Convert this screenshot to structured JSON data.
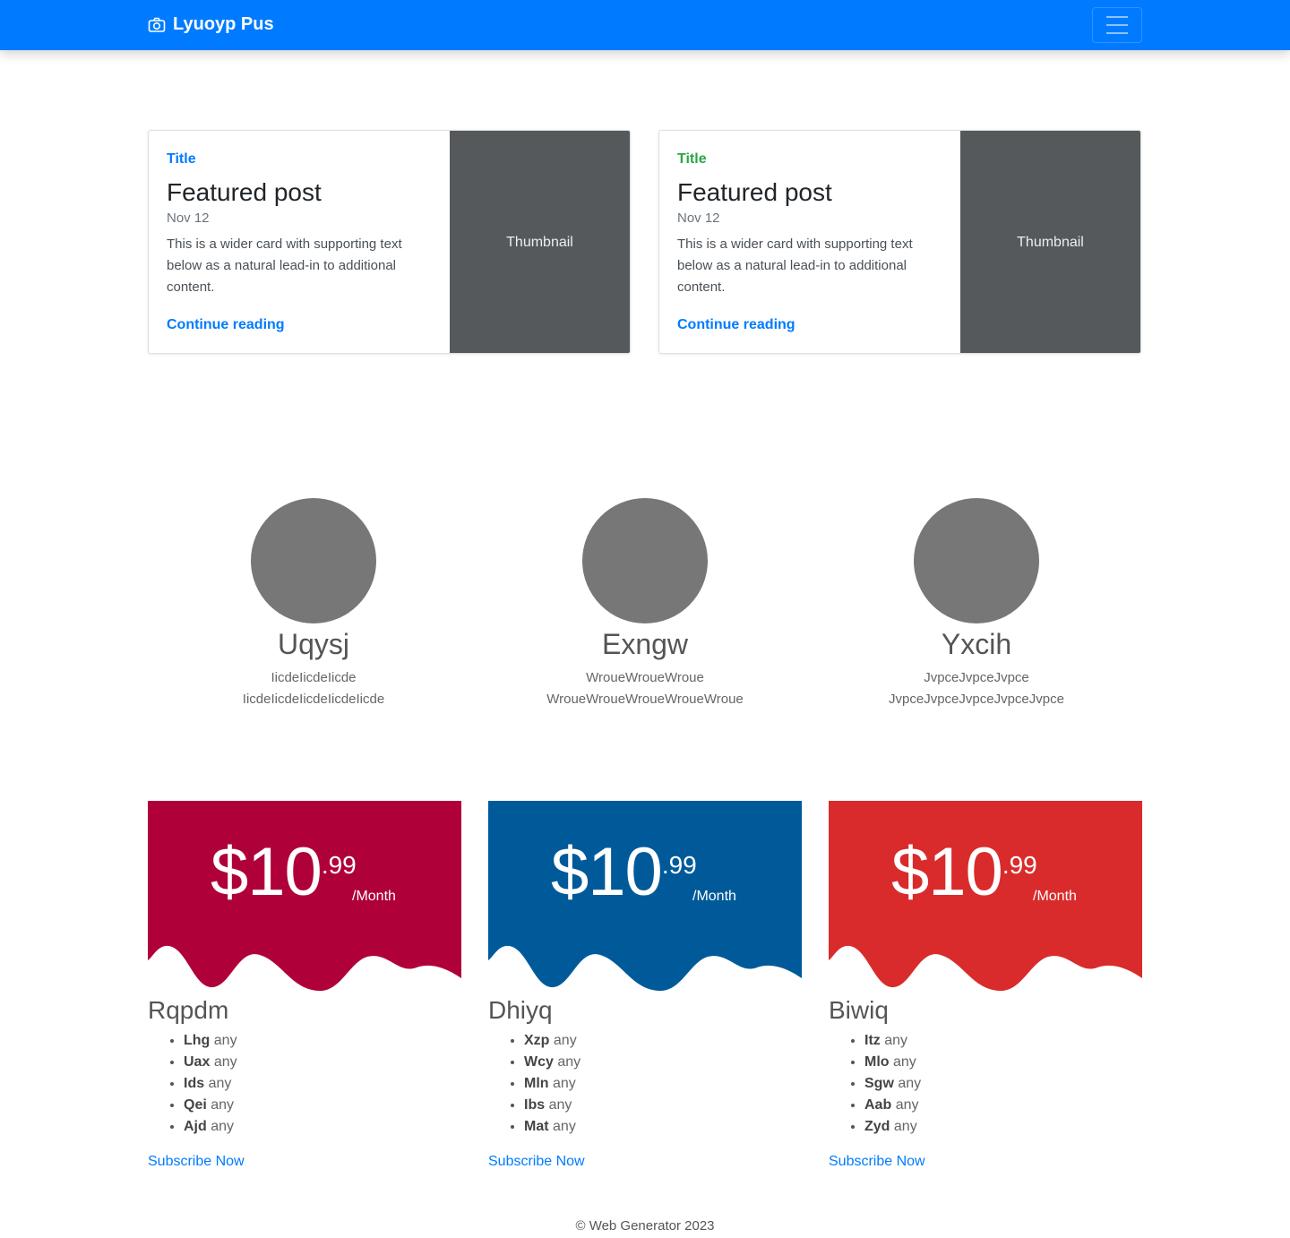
{
  "navbar": {
    "brand": "Lyuoyp Pus",
    "brand_icon": "camera-icon",
    "toggler_icon": "hamburger-menu-icon",
    "color": "#007bff"
  },
  "featured": [
    {
      "category": "Title",
      "category_color": "#007bff",
      "title": "Featured post",
      "date": "Nov 12",
      "text": "This is a wider card with supporting text below as a natural lead-in to additional content.",
      "link": "Continue reading",
      "thumbnail": "Thumbnail"
    },
    {
      "category": "Title",
      "category_color": "#28a745",
      "title": "Featured post",
      "date": "Nov 12",
      "text": "This is a wider card with supporting text below as a natural lead-in to additional content.",
      "link": "Continue reading",
      "thumbnail": "Thumbnail"
    }
  ],
  "team": [
    {
      "name": "Uqysj",
      "line1": "IicdeIicdeIicde",
      "line2": "IicdeIicdeIicdeIicdeIicde"
    },
    {
      "name": "Exngw",
      "line1": "WroueWroueWroue",
      "line2": "WroueWroueWroueWroueWroue"
    },
    {
      "name": "Yxcih",
      "line1": "JvpceJvpceJvpce",
      "line2": "JvpceJvpceJvpceJvpceJvpce"
    }
  ],
  "pricing": [
    {
      "color": "#b0003a",
      "amount": "$10",
      "cents": ".99",
      "period": "/Month",
      "name": "Rqpdm",
      "features": [
        {
          "k": "Lhg",
          "v": "any"
        },
        {
          "k": "Uax",
          "v": "any"
        },
        {
          "k": "Ids",
          "v": "any"
        },
        {
          "k": "Qei",
          "v": "any"
        },
        {
          "k": "Ajd",
          "v": "any"
        }
      ],
      "cta": "Subscribe Now"
    },
    {
      "color": "#005a9a",
      "amount": "$10",
      "cents": ".99",
      "period": "/Month",
      "name": "Dhiyq",
      "features": [
        {
          "k": "Xzp",
          "v": "any"
        },
        {
          "k": "Wcy",
          "v": "any"
        },
        {
          "k": "Mln",
          "v": "any"
        },
        {
          "k": "Ibs",
          "v": "any"
        },
        {
          "k": "Mat",
          "v": "any"
        }
      ],
      "cta": "Subscribe Now"
    },
    {
      "color": "#d92b2b",
      "amount": "$10",
      "cents": ".99",
      "period": "/Month",
      "name": "Biwiq",
      "features": [
        {
          "k": "Itz",
          "v": "any"
        },
        {
          "k": "Mlo",
          "v": "any"
        },
        {
          "k": "Sgw",
          "v": "any"
        },
        {
          "k": "Aab",
          "v": "any"
        },
        {
          "k": "Zyd",
          "v": "any"
        }
      ],
      "cta": "Subscribe Now"
    }
  ],
  "footer": "© Web Generator 2023"
}
